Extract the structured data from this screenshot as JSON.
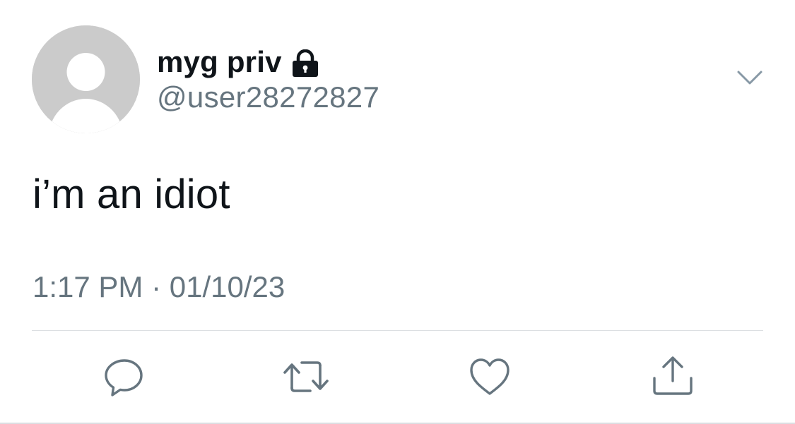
{
  "tweet": {
    "author": {
      "display_name": "myg priv",
      "handle": "@user28272827",
      "protected_icon": "lock-icon",
      "avatar": "default-avatar-icon"
    },
    "text": "i’m an idiot",
    "timestamp": "1:17 PM · 01/10/23",
    "more_menu_icon": "chevron-down-icon",
    "actions": [
      {
        "name": "reply",
        "icon": "reply-icon"
      },
      {
        "name": "retweet",
        "icon": "retweet-icon"
      },
      {
        "name": "like",
        "icon": "heart-icon"
      },
      {
        "name": "share",
        "icon": "share-icon"
      }
    ]
  },
  "colors": {
    "text_primary": "#0f1419",
    "text_secondary": "#66757f",
    "icon_gray": "#66757f",
    "avatar_bg": "#cbcbcb",
    "divider": "#dcdfe2"
  }
}
